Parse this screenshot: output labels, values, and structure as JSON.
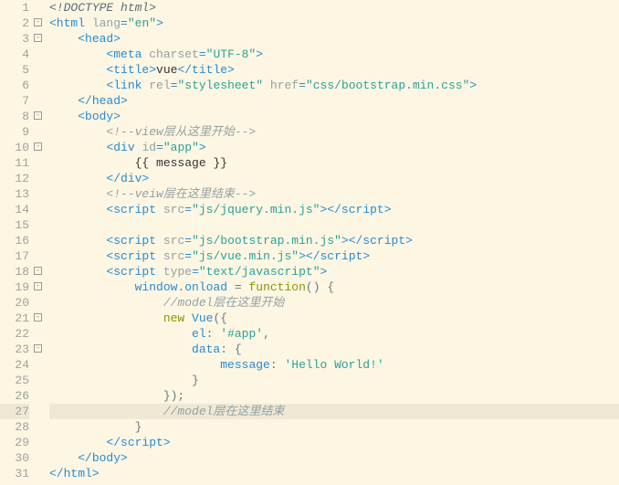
{
  "lines": [
    {
      "n": 1,
      "fold": null,
      "cls": "",
      "html": "<span class='doctype'>&lt;!</span><span class='doctype'>DOCTYPE</span><span class='doctype'> html</span><span class='doctype'>&gt;</span>"
    },
    {
      "n": 2,
      "fold": 3,
      "cls": "",
      "html": "<span class='tag'>&lt;html</span> <span class='attr'>lang</span><span class='tag'>=</span><span class='val'>\"en\"</span><span class='tag'>&gt;</span>"
    },
    {
      "n": 3,
      "fold": 3,
      "cls": "",
      "html": "    <span class='tag'>&lt;head&gt;</span>"
    },
    {
      "n": 4,
      "fold": null,
      "cls": "",
      "html": "        <span class='tag'>&lt;meta</span> <span class='attr'>charset</span><span class='tag'>=</span><span class='val'>\"UTF-8\"</span><span class='tag'>&gt;</span>"
    },
    {
      "n": 5,
      "fold": null,
      "cls": "",
      "html": "        <span class='tag'>&lt;title&gt;</span><span class='txt'>vue</span><span class='tag'>&lt;/title&gt;</span>"
    },
    {
      "n": 6,
      "fold": null,
      "cls": "",
      "html": "        <span class='tag'>&lt;link</span> <span class='attr'>rel</span><span class='tag'>=</span><span class='val'>\"stylesheet\"</span> <span class='attr'>href</span><span class='tag'>=</span><span class='val'>\"css/bootstrap.min.css\"</span><span class='tag'>&gt;</span>"
    },
    {
      "n": 7,
      "fold": null,
      "cls": "",
      "html": "    <span class='tag'>&lt;/head&gt;</span>"
    },
    {
      "n": 8,
      "fold": 3,
      "cls": "",
      "html": "    <span class='tag'>&lt;body&gt;</span>"
    },
    {
      "n": 9,
      "fold": null,
      "cls": "",
      "html": "        <span class='comment'>&lt;!--view层从这里开始--&gt;</span>"
    },
    {
      "n": 10,
      "fold": 3,
      "cls": "",
      "html": "        <span class='tag'>&lt;div</span> <span class='attr'>id</span><span class='tag'>=</span><span class='val'>\"app\"</span><span class='tag'>&gt;</span>"
    },
    {
      "n": 11,
      "fold": null,
      "cls": "",
      "html": "            <span class='txt'>{{ message }}</span>"
    },
    {
      "n": 12,
      "fold": null,
      "cls": "",
      "html": "        <span class='tag'>&lt;/div&gt;</span>"
    },
    {
      "n": 13,
      "fold": null,
      "cls": "",
      "html": "        <span class='comment'>&lt;!--veiw层在这里结束--&gt;</span>"
    },
    {
      "n": 14,
      "fold": null,
      "cls": "",
      "html": "        <span class='tag'>&lt;script</span> <span class='attr'>src</span><span class='tag'>=</span><span class='val'>\"js/jquery.min.js\"</span><span class='tag'>&gt;</span><span class='tag'>&lt;/script&gt;</span>"
    },
    {
      "n": 15,
      "fold": null,
      "cls": "",
      "html": ""
    },
    {
      "n": 16,
      "fold": null,
      "cls": "",
      "html": "        <span class='tag'>&lt;script</span> <span class='attr'>src</span><span class='tag'>=</span><span class='val'>\"js/bootstrap.min.js\"</span><span class='tag'>&gt;</span><span class='tag'>&lt;/script&gt;</span>"
    },
    {
      "n": 17,
      "fold": null,
      "cls": "",
      "html": "        <span class='tag'>&lt;script</span> <span class='attr'>src</span><span class='tag'>=</span><span class='val'>\"js/vue.min.js\"</span><span class='tag'>&gt;</span><span class='tag'>&lt;/script&gt;</span>"
    },
    {
      "n": 18,
      "fold": 3,
      "cls": "",
      "html": "        <span class='tag'>&lt;script</span> <span class='attr'>type</span><span class='tag'>=</span><span class='val'>\"text/javascript\"</span><span class='tag'>&gt;</span>"
    },
    {
      "n": 19,
      "fold": 3,
      "cls": "",
      "html": "            <span class='js-id'>window</span><span class='js-punc'>.</span><span class='js-id'>onload</span> <span class='js-punc'>=</span> <span class='js-kw'>function</span><span class='js-punc'>()</span> <span class='js-punc'>{</span>"
    },
    {
      "n": 20,
      "fold": null,
      "cls": "",
      "html": "                <span class='comment'>//model层在这里开始</span>"
    },
    {
      "n": 21,
      "fold": 3,
      "cls": "",
      "html": "                <span class='js-kw'>new</span> <span class='js-id'>Vue</span><span class='js-punc'>({</span>"
    },
    {
      "n": 22,
      "fold": null,
      "cls": "",
      "html": "                    <span class='js-id'>el</span><span class='js-punc'>:</span> <span class='js-str'>'#app'</span><span class='js-punc'>,</span>"
    },
    {
      "n": 23,
      "fold": 3,
      "cls": "",
      "html": "                    <span class='js-id'>data</span><span class='js-punc'>:</span> <span class='js-punc'>{</span>"
    },
    {
      "n": 24,
      "fold": null,
      "cls": "",
      "html": "                        <span class='js-id'>message</span><span class='js-punc'>:</span> <span class='js-str'>'Hello World!'</span>"
    },
    {
      "n": 25,
      "fold": null,
      "cls": "",
      "html": "                    <span class='js-punc'>}</span>"
    },
    {
      "n": 26,
      "fold": null,
      "cls": "",
      "html": "                <span class='js-punc'>});</span>"
    },
    {
      "n": 27,
      "fold": null,
      "cls": "hl",
      "html": "                <span class='comment'>//model层在这里结束</span>"
    },
    {
      "n": 28,
      "fold": null,
      "cls": "",
      "html": "            <span class='js-punc'>}</span>"
    },
    {
      "n": 29,
      "fold": null,
      "cls": "",
      "html": "        <span class='tag'>&lt;/script&gt;</span>"
    },
    {
      "n": 30,
      "fold": null,
      "cls": "",
      "html": "    <span class='tag'>&lt;/body&gt;</span>"
    },
    {
      "n": 31,
      "fold": null,
      "cls": "",
      "html": "<span class='tag'>&lt;/html&gt;</span>"
    }
  ]
}
